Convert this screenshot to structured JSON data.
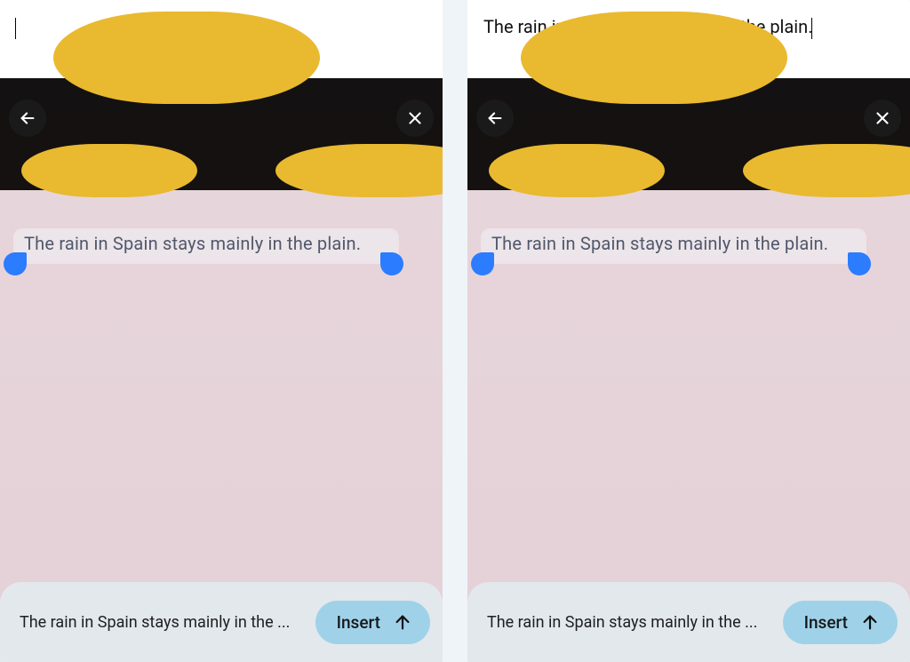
{
  "panes": {
    "left": {
      "doc_text": "",
      "ocr_text": "The rain in Spain stays mainly in the plain.",
      "preview_text": "The rain in Spain stays mainly in the ...",
      "insert_label": "Insert"
    },
    "right": {
      "doc_text": "The rain in Spain stays mainly in the plain.",
      "ocr_text": "The rain in Spain stays mainly in the plain.",
      "preview_text": "The rain in Spain stays mainly in the ...",
      "insert_label": "Insert"
    }
  },
  "icons": {
    "back": "arrow-left",
    "close": "x",
    "insert": "arrow-up"
  },
  "colors": {
    "selection_handle": "#2b7cff",
    "insert_button": "#9fd2e9",
    "sheet_bg": "#e3e8ec"
  }
}
